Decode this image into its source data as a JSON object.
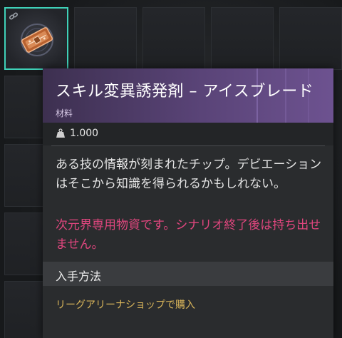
{
  "item": {
    "name": "スキル変異誘発剤 – アイスブレード",
    "category": "材料",
    "weight": "1.000",
    "description": "ある技の情報が刻まれたチップ。デビエーションはそこから知識を得られるかもしれない。",
    "warning": "次元界専用物資です。シナリオ終了後は持ち出せません。",
    "acquisition_title": "入手方法",
    "acquisition_source": "リーグアリーナショップで購入"
  },
  "icons": {
    "slot_link": "link-icon",
    "weight": "weight-icon",
    "item_art": "chip-item-icon"
  },
  "colors": {
    "selection_border": "#3fd1b8",
    "header_purple": "#5a4478",
    "warning_text": "#e0467e",
    "source_text": "#d9b55a"
  }
}
